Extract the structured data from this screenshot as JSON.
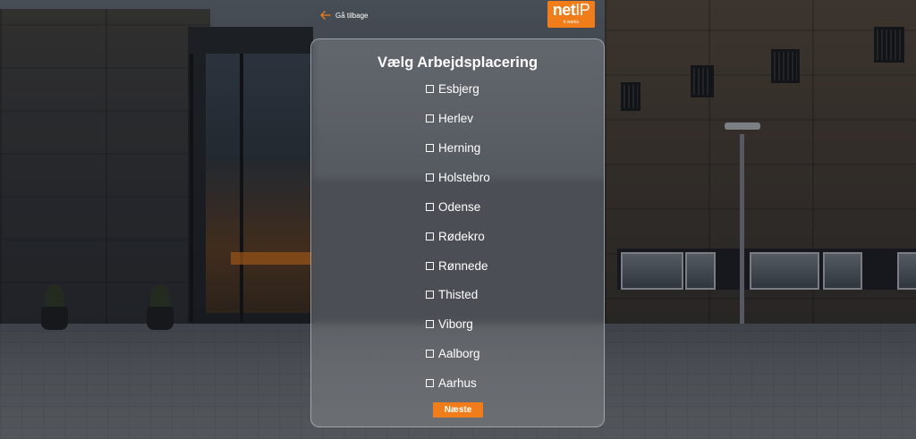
{
  "header": {
    "back_label": "Gå tilbage",
    "logo": {
      "brand_net": "net",
      "brand_ip": "IP",
      "tagline": "it works",
      "color": "#f07d1a"
    }
  },
  "card": {
    "title": "Vælg Arbejdsplacering",
    "options": [
      {
        "label": "Esbjerg",
        "checked": false
      },
      {
        "label": "Herlev",
        "checked": false
      },
      {
        "label": "Herning",
        "checked": false
      },
      {
        "label": "Holstebro",
        "checked": false
      },
      {
        "label": "Odense",
        "checked": false
      },
      {
        "label": "Rødekro",
        "checked": false
      },
      {
        "label": "Rønnede",
        "checked": false
      },
      {
        "label": "Thisted",
        "checked": false
      },
      {
        "label": "Viborg",
        "checked": false
      },
      {
        "label": "Aalborg",
        "checked": false
      },
      {
        "label": "Aarhus",
        "checked": false
      }
    ],
    "next_label": "Næste"
  },
  "colors": {
    "accent": "#f07d1a",
    "text": "#ffffff"
  }
}
